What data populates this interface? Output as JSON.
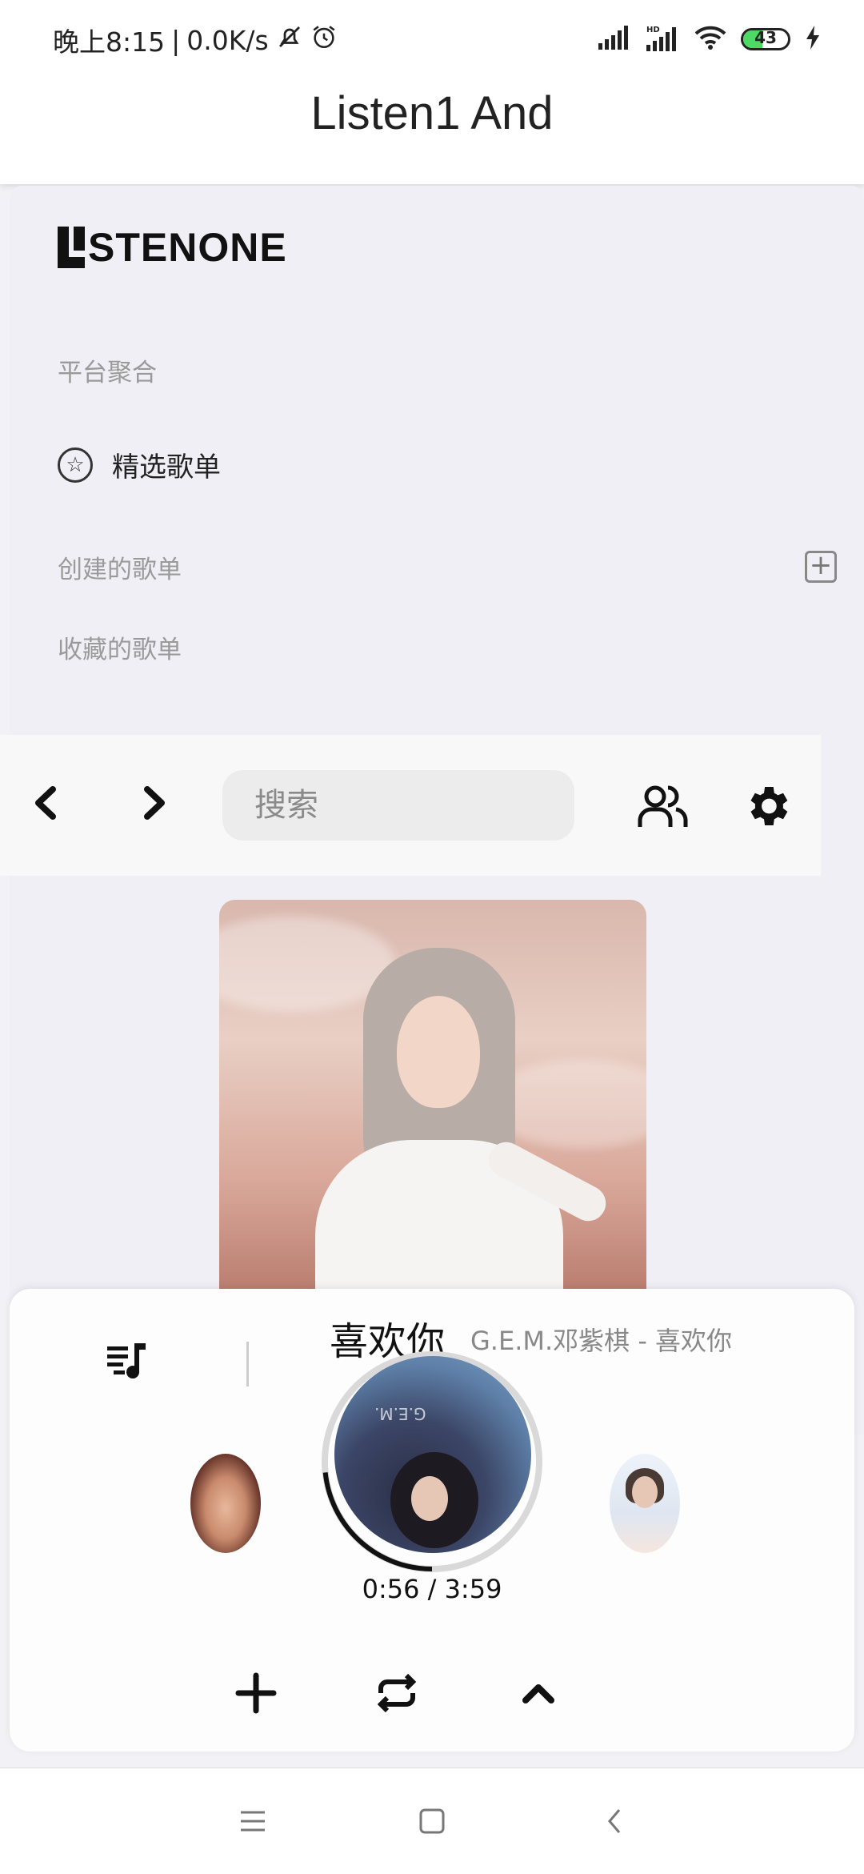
{
  "status_bar": {
    "time": "晚上8:15",
    "separator": "|",
    "speed": "0.0K/s",
    "battery": "43"
  },
  "app": {
    "title": "Listen1 And"
  },
  "sidebar": {
    "logo_text": "STENONE",
    "section_platform": "平台聚合",
    "featured_playlists": "精选歌单",
    "section_created": "创建的歌单",
    "section_favorites": "收藏的歌单"
  },
  "toolbar": {
    "back_icon": "chevron-left-icon",
    "forward_icon": "chevron-right-icon",
    "search_placeholder": "搜索",
    "user_icon": "users-icon",
    "settings_icon": "gear-icon"
  },
  "player": {
    "song_title": "喜欢你",
    "song_subtitle": "G.E.M.邓紫棋 - 喜欢你",
    "time_display": "0:56 / 3:59",
    "progress": 0.234,
    "controls": [
      "add-icon",
      "repeat-icon",
      "chevron-up-icon"
    ]
  },
  "colors": {
    "background": "#f2f2f6",
    "battery_fill": "#4cd964",
    "muted_text": "#9a9a9a"
  }
}
